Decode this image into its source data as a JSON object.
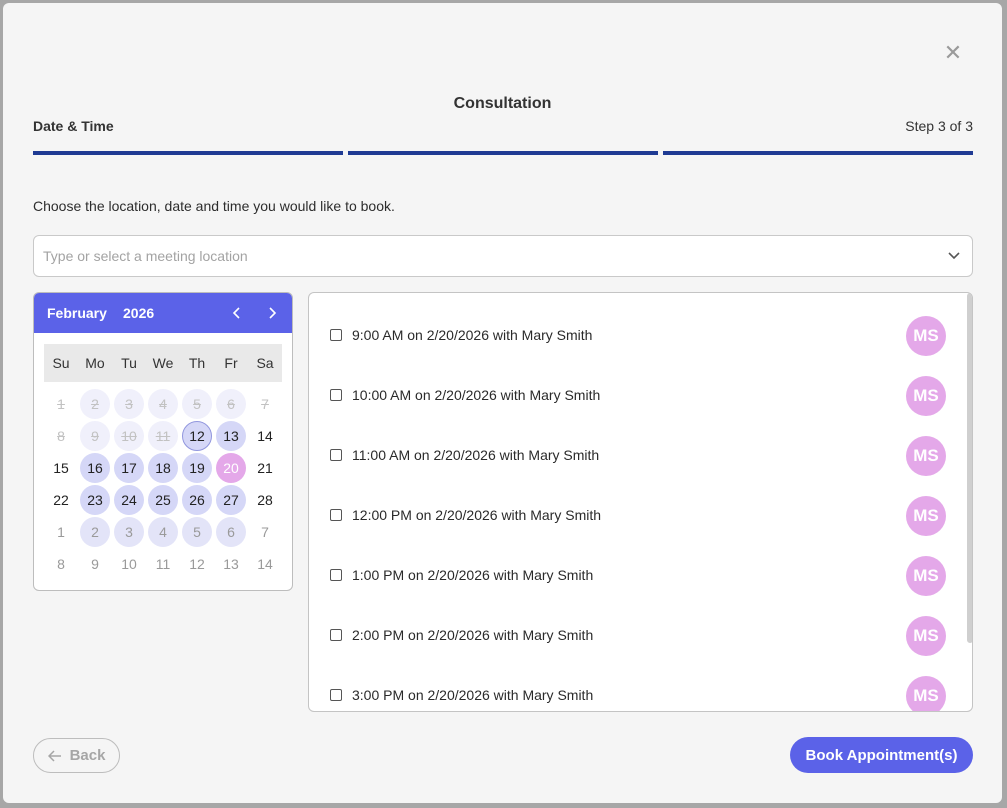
{
  "modal": {
    "title": "Consultation",
    "step_name": "Date & Time",
    "step_count": "Step 3 of 3",
    "close_icon": "close-icon"
  },
  "instructions": "Choose the location, date and time you would like to book.",
  "location": {
    "placeholder": "Type or select a meeting location",
    "value": ""
  },
  "calendar": {
    "month": "February",
    "year": "2026",
    "weekdays": [
      "Su",
      "Mo",
      "Tu",
      "We",
      "Th",
      "Fr",
      "Sa"
    ],
    "days": [
      {
        "d": "1",
        "s": "past"
      },
      {
        "d": "2",
        "s": "past avail"
      },
      {
        "d": "3",
        "s": "past avail"
      },
      {
        "d": "4",
        "s": "past avail"
      },
      {
        "d": "5",
        "s": "past avail"
      },
      {
        "d": "6",
        "s": "past avail"
      },
      {
        "d": "7",
        "s": "past"
      },
      {
        "d": "8",
        "s": "past"
      },
      {
        "d": "9",
        "s": "past avail"
      },
      {
        "d": "10",
        "s": "past avail"
      },
      {
        "d": "11",
        "s": "past avail"
      },
      {
        "d": "12",
        "s": "avail today"
      },
      {
        "d": "13",
        "s": "avail"
      },
      {
        "d": "14",
        "s": ""
      },
      {
        "d": "15",
        "s": ""
      },
      {
        "d": "16",
        "s": "avail"
      },
      {
        "d": "17",
        "s": "avail"
      },
      {
        "d": "18",
        "s": "avail"
      },
      {
        "d": "19",
        "s": "avail"
      },
      {
        "d": "20",
        "s": "selected"
      },
      {
        "d": "21",
        "s": ""
      },
      {
        "d": "22",
        "s": ""
      },
      {
        "d": "23",
        "s": "avail"
      },
      {
        "d": "24",
        "s": "avail"
      },
      {
        "d": "25",
        "s": "avail"
      },
      {
        "d": "26",
        "s": "avail"
      },
      {
        "d": "27",
        "s": "avail"
      },
      {
        "d": "28",
        "s": ""
      },
      {
        "d": "1",
        "s": "next"
      },
      {
        "d": "2",
        "s": "next avail"
      },
      {
        "d": "3",
        "s": "next avail"
      },
      {
        "d": "4",
        "s": "next avail"
      },
      {
        "d": "5",
        "s": "next avail"
      },
      {
        "d": "6",
        "s": "next avail"
      },
      {
        "d": "7",
        "s": "next"
      },
      {
        "d": "8",
        "s": "next"
      },
      {
        "d": "9",
        "s": "next"
      },
      {
        "d": "10",
        "s": "next"
      },
      {
        "d": "11",
        "s": "next"
      },
      {
        "d": "12",
        "s": "next"
      },
      {
        "d": "13",
        "s": "next"
      },
      {
        "d": "14",
        "s": "next"
      }
    ]
  },
  "slots": [
    {
      "label": "9:00 AM on 2/20/2026 with Mary Smith",
      "initials": "MS"
    },
    {
      "label": "10:00 AM on 2/20/2026 with Mary Smith",
      "initials": "MS"
    },
    {
      "label": "11:00 AM on 2/20/2026 with Mary Smith",
      "initials": "MS"
    },
    {
      "label": "12:00 PM on 2/20/2026 with Mary Smith",
      "initials": "MS"
    },
    {
      "label": "1:00 PM on 2/20/2026 with Mary Smith",
      "initials": "MS"
    },
    {
      "label": "2:00 PM on 2/20/2026 with Mary Smith",
      "initials": "MS"
    },
    {
      "label": "3:00 PM on 2/20/2026 with Mary Smith",
      "initials": "MS"
    }
  ],
  "footer": {
    "back_label": "Back",
    "book_label": "Book Appointment(s)"
  },
  "colors": {
    "accent": "#5b62e8",
    "progress": "#1f3a93",
    "avatar": "#e4a8e9",
    "available_day": "#d5d7f7"
  }
}
